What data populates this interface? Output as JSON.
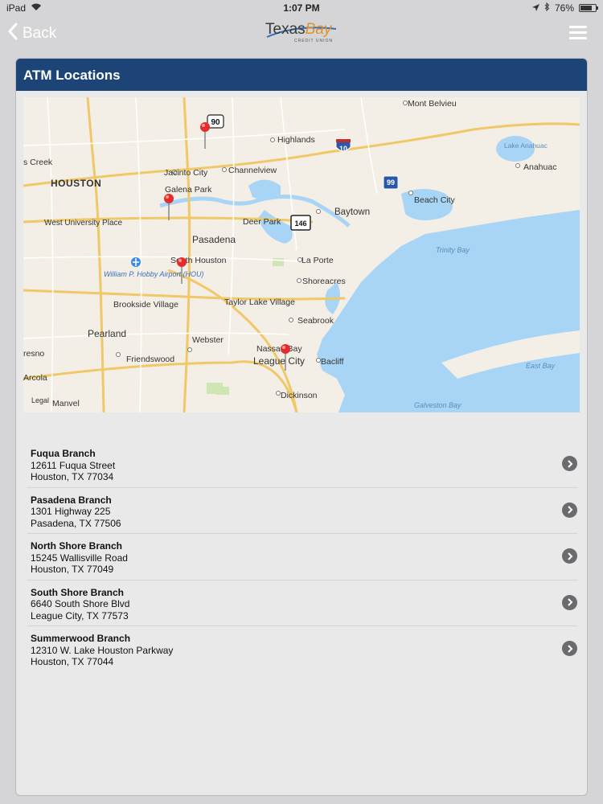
{
  "status_bar": {
    "device": "iPad",
    "time": "1:07 PM",
    "battery": "76%",
    "battery_level": 0.76
  },
  "nav": {
    "back_label": "Back",
    "logo_main": "Texas",
    "logo_accent": "Bay",
    "logo_sub": "CREDIT UNION"
  },
  "panel": {
    "title": "ATM Locations"
  },
  "map": {
    "legal": "Legal",
    "labels": {
      "mont_belvieu": "Mont Belvieu",
      "highlands": "Highlands",
      "lake_anahuac": "Lake Anahuac",
      "anahuac": "Anahuac",
      "creek": "s Creek",
      "houston": "HOUSTON",
      "jacinto_city": "Jacinto City",
      "channelview": "Channelview",
      "galena_park": "Galena Park",
      "beach_city": "Beach City",
      "west_university": "West University Place",
      "deer_park": "Deer Park",
      "baytown": "Baytown",
      "pasadena": "Pasadena",
      "trinity_bay": "Trinity Bay",
      "south_houston": "South Houston",
      "la_porte": "La Porte",
      "hobby_airport": "William P. Hobby Airport (HOU)",
      "shoreacres": "Shoreacres",
      "brookside": "Brookside Village",
      "taylor_lake": "Taylor Lake Village",
      "pearland": "Pearland",
      "seabrook": "Seabrook",
      "webster": "Webster",
      "nassau_bay": "Nassau Bay",
      "resno": "resno",
      "friendswood": "Friendswood",
      "league_city": "League City",
      "bacliff": "Bacliff",
      "east_bay": "East Bay",
      "arcola": "Arcola",
      "dickinson": "Dickinson",
      "manvel": "Manvel",
      "galveston_bay": "Galveston Bay"
    },
    "shields": {
      "us90": "90",
      "i10": "10",
      "tx146": "146",
      "tx99": "99"
    }
  },
  "branches": [
    {
      "name": "Fuqua Branch",
      "street": "12611 Fuqua Street",
      "city": "Houston, TX 77034"
    },
    {
      "name": "Pasadena Branch",
      "street": "1301 Highway 225",
      "city": "Pasadena, TX 77506"
    },
    {
      "name": "North Shore Branch",
      "street": "15245 Wallisville Road",
      "city": "Houston, TX 77049"
    },
    {
      "name": "South Shore Branch",
      "street": "6640 South Shore Blvd",
      "city": "League City, TX 77573"
    },
    {
      "name": "Summerwood Branch",
      "street": "12310 W. Lake Houston Parkway",
      "city": "Houston, TX 77044"
    }
  ],
  "colors": {
    "header": "#1c4476",
    "water": "#a8d4f5",
    "road": "#f6d37c",
    "pin": "#e52b2b"
  }
}
